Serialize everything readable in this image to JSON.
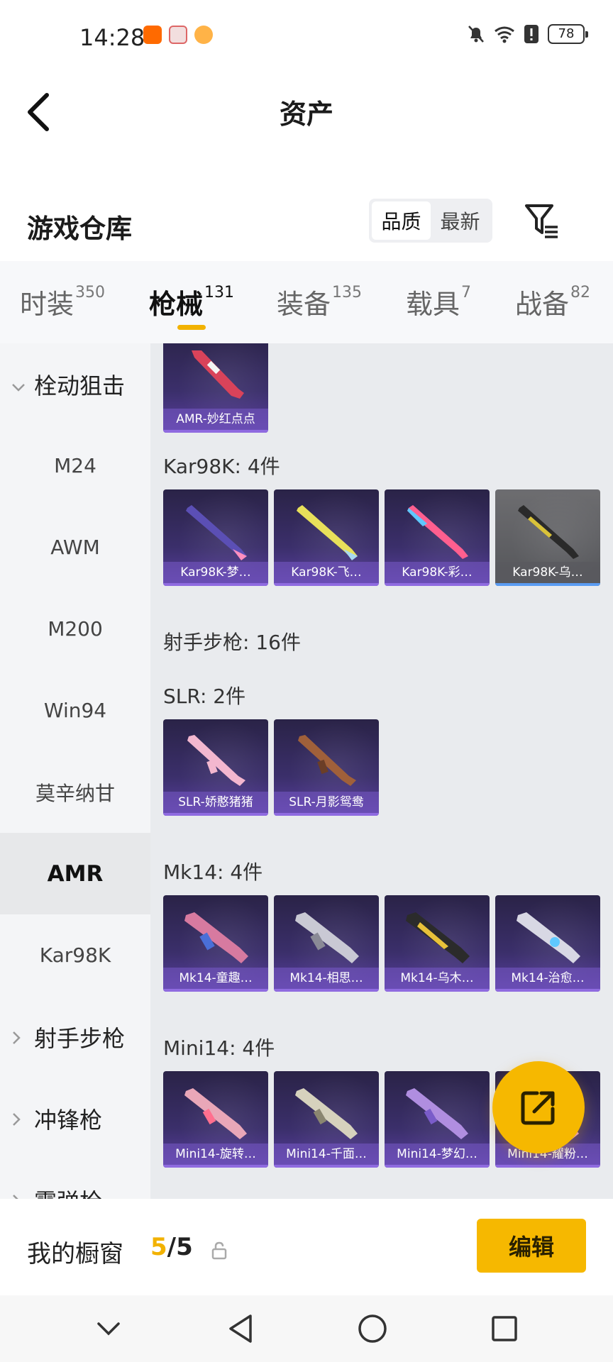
{
  "status": {
    "time": "14:28",
    "battery": "78"
  },
  "header": {
    "title": "资产"
  },
  "warehouse": {
    "title": "游戏仓库",
    "sort_options": [
      "品质",
      "最新"
    ],
    "active_sort": "品质"
  },
  "tabs": [
    {
      "label": "时装",
      "count": "350"
    },
    {
      "label": "枪械",
      "count": "131"
    },
    {
      "label": "装备",
      "count": "135"
    },
    {
      "label": "载具",
      "count": "7"
    },
    {
      "label": "战备",
      "count": "82"
    }
  ],
  "active_tab": "枪械",
  "sidebar": {
    "group_sniper": "栓动狙击",
    "items": [
      "M24",
      "AWM",
      "M200",
      "Win94",
      "莫辛纳甘",
      "AMR",
      "Kar98K"
    ],
    "active_item": "AMR",
    "group_marksman": "射手步枪",
    "group_smg": "冲锋枪",
    "group_shotgun": "霰弹枪"
  },
  "content": {
    "amr_card": "AMR-妙红点点",
    "kar98k_title": "Kar98K: 4件",
    "kar98k_cards": [
      "Kar98K-梦…",
      "Kar98K-飞…",
      "Kar98K-彩…",
      "Kar98K-乌…"
    ],
    "marksman_title": "射手步枪: 16件",
    "slr_title": "SLR: 2件",
    "slr_cards": [
      "SLR-娇憨猪猪",
      "SLR-月影鸳鸯"
    ],
    "mk14_title": "Mk14: 4件",
    "mk14_cards": [
      "Mk14-童趣…",
      "Mk14-相思…",
      "Mk14-乌木…",
      "Mk14-治愈…"
    ],
    "mini14_title": "Mini14: 4件",
    "mini14_cards": [
      "Mini14-旋转…",
      "Mini14-千面…",
      "Mini14-梦幻…",
      "Mini14-耀粉…"
    ]
  },
  "bottom": {
    "window_label": "我的橱窗",
    "window_current": "5",
    "window_total": "/5",
    "edit_label": "编辑"
  },
  "colors": {
    "accent": "#f6b800",
    "card_purple": "#3b2f6b",
    "tab_underline": "#f2b200"
  }
}
